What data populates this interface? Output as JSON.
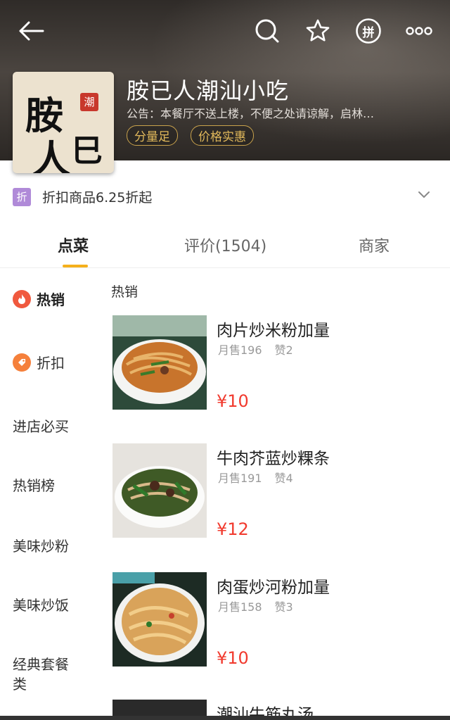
{
  "header": {
    "store_name": "胺已人潮汕小吃",
    "notice": "公告：本餐厅不送上楼，不便之处请谅解，启林…",
    "tags": [
      "分量足",
      "价格实惠"
    ],
    "logo_text": [
      "胺",
      "巳",
      "人",
      "潮"
    ],
    "topbar_icons": [
      "back-arrow-icon",
      "search-icon",
      "star-icon",
      "group-buy-icon",
      "more-icon"
    ],
    "group_buy_char": "拼"
  },
  "discount": {
    "badge": "折",
    "text": "折扣商品6.25折起"
  },
  "tabs": [
    {
      "label": "点菜",
      "active": true
    },
    {
      "label": "评价(1504)",
      "active": false
    },
    {
      "label": "商家",
      "active": false
    }
  ],
  "sidebar": {
    "items": [
      {
        "label": "热销",
        "icon": "flame-icon"
      },
      {
        "label": "折扣",
        "icon": "discount-icon"
      },
      {
        "label": "进店必买"
      },
      {
        "label": "热销榜"
      },
      {
        "label": "美味炒粉"
      },
      {
        "label": "美味炒饭"
      },
      {
        "label": "经典套餐类"
      }
    ]
  },
  "menu": {
    "section_title": "热销",
    "items": [
      {
        "name": "肉片炒米粉加量",
        "monthly_sales": "月售196",
        "likes": "赞2",
        "price": "¥10"
      },
      {
        "name": "牛肉芥蓝炒粿条",
        "monthly_sales": "月售191",
        "likes": "赞4",
        "price": "¥12"
      },
      {
        "name": "肉蛋炒河粉加量",
        "monthly_sales": "月售158",
        "likes": "赞3",
        "price": "¥10"
      },
      {
        "name": "潮汕牛筋丸汤",
        "monthly_sales": "",
        "likes": "",
        "price": ""
      }
    ]
  },
  "colors": {
    "accent": "#f5b01b",
    "price": "#f13a2e",
    "tag_gold": "#e0b85b",
    "discount_badge": "#b08ad8",
    "hot_icon": "#f0593e",
    "discount_icon": "#f5803b"
  }
}
